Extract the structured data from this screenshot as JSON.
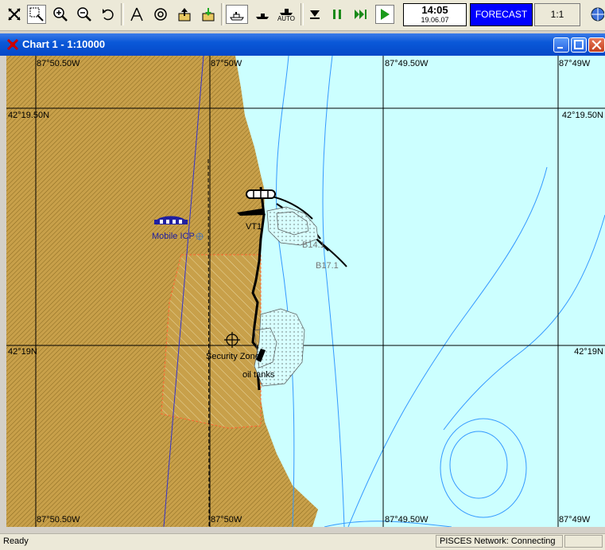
{
  "toolbar": {
    "tools": [
      {
        "name": "select-tool-icon"
      },
      {
        "name": "zoom-window-icon"
      },
      {
        "name": "zoom-in-icon"
      },
      {
        "name": "zoom-out-icon"
      },
      {
        "name": "undo-view-icon"
      },
      {
        "name": "measure-icon"
      },
      {
        "name": "target-icon"
      },
      {
        "name": "export-icon"
      },
      {
        "name": "import-icon"
      },
      {
        "name": "ship-mode-icon"
      },
      {
        "name": "ship-follow-icon"
      },
      {
        "name": "ship-auto-icon",
        "label": "AUTO"
      },
      {
        "name": "stop-icon"
      },
      {
        "name": "pause-icon"
      },
      {
        "name": "fast-forward-icon"
      },
      {
        "name": "play-icon"
      }
    ],
    "time": "14:05",
    "date": "19.06.07",
    "forecast_label": "FORECAST",
    "scale_label": "1:1"
  },
  "window": {
    "title": "Chart 1 - 1:10000"
  },
  "chart": {
    "lon_labels_top": [
      "87°50.50W",
      "87°50W",
      "87°49.50W",
      "87°49W"
    ],
    "lon_labels_bottom": [
      "87°50.50W",
      "87°50W",
      "87°49.50W",
      "87°49W"
    ],
    "lat_labels_left": [
      "42°19.50N",
      "42°19N"
    ],
    "lat_labels_right": [
      "42°19.50N",
      "42°19N"
    ],
    "features": {
      "mobile_icp": "Mobile ICP",
      "vt1": "VT1",
      "b14": "B14.1",
      "b17": "B17.1",
      "security_zone": "Security Zone",
      "oil_tanks": "oil tanks"
    },
    "colors": {
      "land": "#c8a04a",
      "water": "#ccffff",
      "depth_contour": "#3399ff",
      "grid": "#000080",
      "security_zone": "#ff6633"
    }
  },
  "status": {
    "left": "Ready",
    "network": "PISCES Network: Connecting"
  }
}
